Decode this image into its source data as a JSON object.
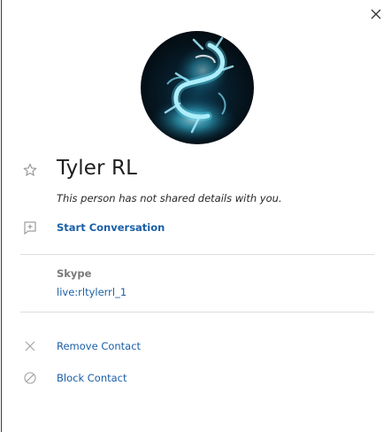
{
  "panel": {
    "close_icon": "close-icon",
    "avatar_icon": "dragon-avatar"
  },
  "contact": {
    "name": "Tyler RL",
    "notice": "This person has not shared details with you.",
    "favorite_icon": "star-outline-icon"
  },
  "actions": {
    "start_conversation": "Start Conversation",
    "start_icon": "new-chat-icon"
  },
  "skype": {
    "label": "Skype",
    "id": "live:rltylerrl_1"
  },
  "manage": {
    "remove_label": "Remove Contact",
    "remove_icon": "x-icon",
    "block_label": "Block Contact",
    "block_icon": "block-icon"
  },
  "colors": {
    "accent": "#1a5fa8",
    "text": "#1e1e1e",
    "muted": "#7a7a7a",
    "divider": "#dcdcdc"
  }
}
